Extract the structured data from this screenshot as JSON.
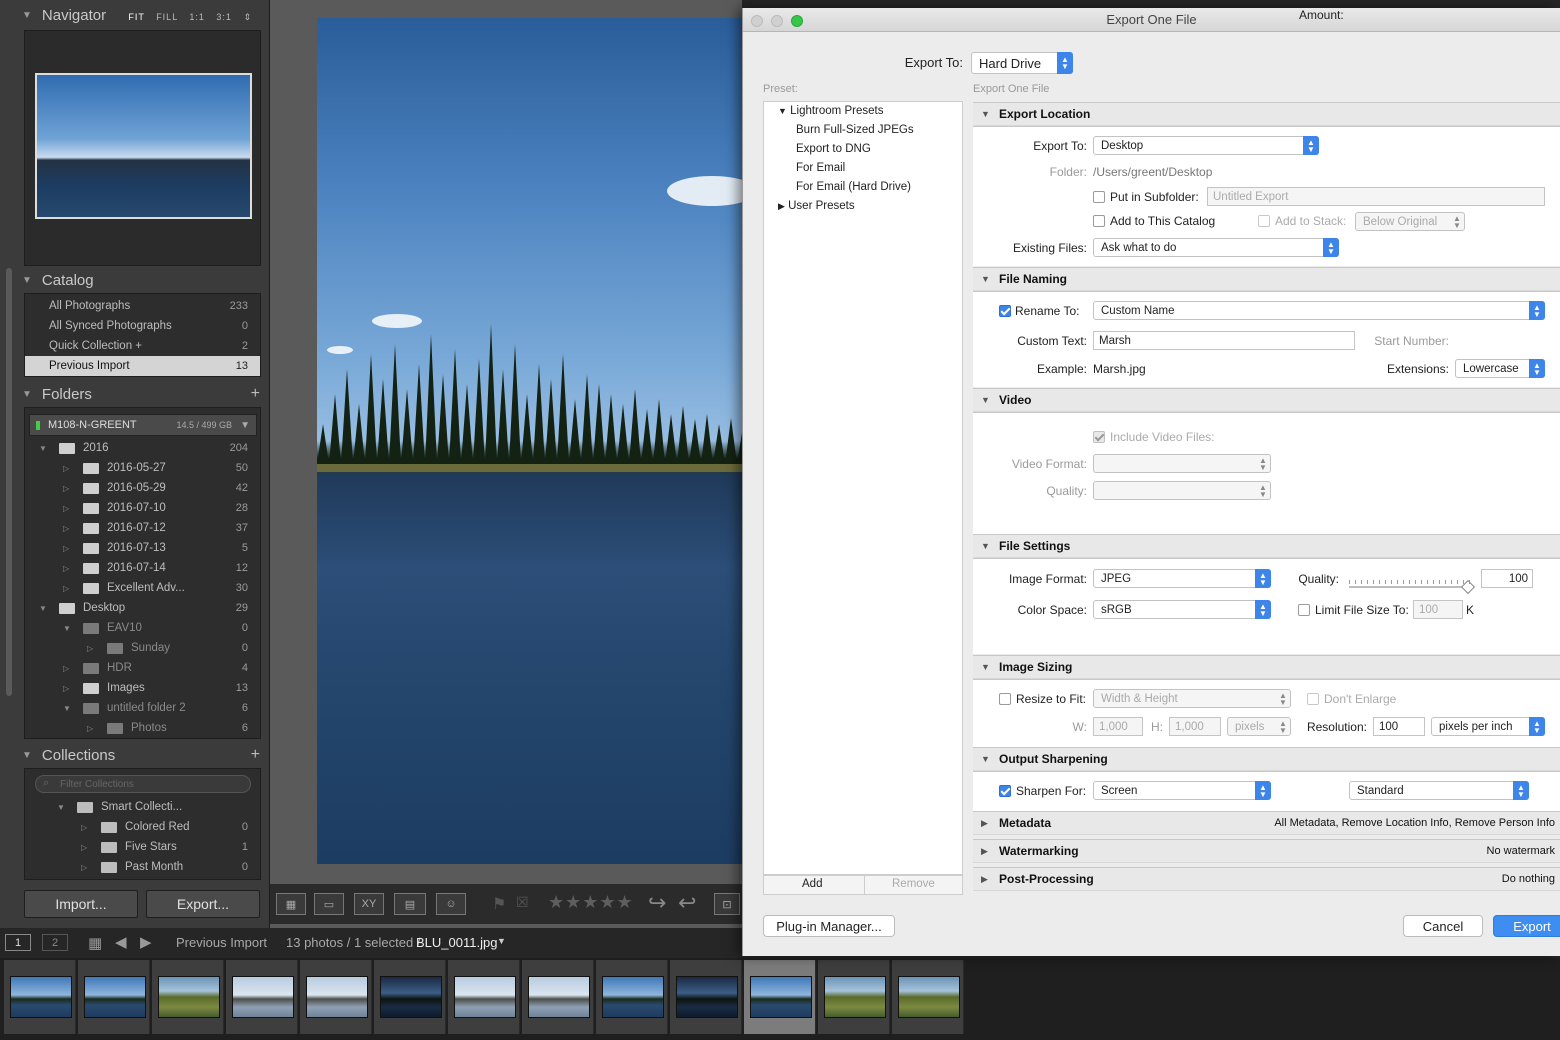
{
  "navigator": {
    "title": "Navigator",
    "modes": [
      "FIT",
      "FILL",
      "1:1",
      "3:1"
    ]
  },
  "catalog": {
    "title": "Catalog",
    "items": [
      {
        "label": "All Photographs",
        "count": "233"
      },
      {
        "label": "All Synced Photographs",
        "count": "0"
      },
      {
        "label": "Quick Collection +",
        "count": "2"
      },
      {
        "label": "Previous Import",
        "count": "13"
      }
    ]
  },
  "folders": {
    "title": "Folders",
    "volume": {
      "name": "M108-N-GREENT",
      "size": "14.5 / 499 GB"
    },
    "items": [
      {
        "label": "2016",
        "count": "204"
      },
      {
        "label": "2016-05-27",
        "count": "50"
      },
      {
        "label": "2016-05-29",
        "count": "42"
      },
      {
        "label": "2016-07-10",
        "count": "28"
      },
      {
        "label": "2016-07-12",
        "count": "37"
      },
      {
        "label": "2016-07-13",
        "count": "5"
      },
      {
        "label": "2016-07-14",
        "count": "12"
      },
      {
        "label": "Excellent Adv...",
        "count": "30"
      },
      {
        "label": "Desktop",
        "count": "29"
      },
      {
        "label": "EAV10",
        "count": "0"
      },
      {
        "label": "Sunday",
        "count": "0"
      },
      {
        "label": "HDR",
        "count": "4"
      },
      {
        "label": "Images",
        "count": "13"
      },
      {
        "label": "untitled folder 2",
        "count": "6"
      },
      {
        "label": "Photos",
        "count": "6"
      }
    ]
  },
  "collections": {
    "title": "Collections",
    "filter_placeholder": "Filter Collections",
    "items": [
      {
        "label": "Smart Collecti...",
        "count": ""
      },
      {
        "label": "Colored Red",
        "count": "0"
      },
      {
        "label": "Five Stars",
        "count": "1"
      },
      {
        "label": "Past Month",
        "count": "0"
      }
    ]
  },
  "left_buttons": {
    "import": "Import...",
    "export": "Export..."
  },
  "filmstrip": {
    "page1": "1",
    "page2": "2",
    "source": "Previous Import",
    "status": "13 photos / 1 selected /",
    "filename": "BLU_0011.jpg"
  },
  "dialog": {
    "title": "Export One File",
    "export_to_label": "Export To:",
    "export_to_value": "Hard Drive",
    "preset_label": "Preset:",
    "preset_name": "Export One File",
    "presets": {
      "lightroom": "Lightroom Presets",
      "items": [
        "Burn Full-Sized JPEGs",
        "Export to DNG",
        "For Email",
        "For Email (Hard Drive)"
      ],
      "user": "User Presets"
    },
    "add_button": "Add",
    "remove_button": "Remove",
    "export_location": {
      "title": "Export Location",
      "export_to_label": "Export To:",
      "export_to_value": "Desktop",
      "folder_label": "Folder:",
      "folder_value": "/Users/greent/Desktop",
      "subfolder_label": "Put in Subfolder:",
      "subfolder_placeholder": "Untitled Export",
      "add_catalog_label": "Add to This Catalog",
      "add_stack_label": "Add to Stack:",
      "stack_value": "Below Original",
      "existing_label": "Existing Files:",
      "existing_value": "Ask what to do"
    },
    "file_naming": {
      "title": "File Naming",
      "rename_label": "Rename To:",
      "rename_value": "Custom Name",
      "custom_text_label": "Custom Text:",
      "custom_text_value": "Marsh",
      "start_number_label": "Start Number:",
      "example_label": "Example:",
      "example_value": "Marsh.jpg",
      "extensions_label": "Extensions:",
      "extensions_value": "Lowercase"
    },
    "video": {
      "title": "Video",
      "include_label": "Include Video Files:",
      "format_label": "Video Format:",
      "quality_label": "Quality:"
    },
    "file_settings": {
      "title": "File Settings",
      "format_label": "Image Format:",
      "format_value": "JPEG",
      "quality_label": "Quality:",
      "quality_value": "100",
      "quality_fraction": 1.0,
      "color_label": "Color Space:",
      "color_value": "sRGB",
      "limit_label": "Limit File Size To:",
      "limit_value": "100",
      "limit_unit": "K"
    },
    "image_sizing": {
      "title": "Image Sizing",
      "resize_label": "Resize to Fit:",
      "resize_value": "Width & Height",
      "dont_enlarge": "Don't Enlarge",
      "w_label": "W:",
      "w_value": "1,000",
      "h_label": "H:",
      "h_value": "1,000",
      "unit_value": "pixels",
      "resolution_label": "Resolution:",
      "resolution_value": "100",
      "resolution_unit": "pixels per inch"
    },
    "output_sharpening": {
      "title": "Output Sharpening",
      "sharpen_label": "Sharpen For:",
      "sharpen_value": "Screen",
      "amount_label": "Amount:",
      "amount_value": "Standard"
    },
    "metadata": {
      "title": "Metadata",
      "summary": "All Metadata, Remove Location Info, Remove Person Info"
    },
    "watermarking": {
      "title": "Watermarking",
      "summary": "No watermark"
    },
    "post_processing": {
      "title": "Post-Processing",
      "summary": "Do nothing"
    },
    "plugin_button": "Plug-in Manager...",
    "cancel_button": "Cancel",
    "export_button": "Export"
  },
  "colors": {
    "accent": "#3d85e8",
    "panel": "#3b3b3b",
    "selected_row": "#d4d4d4"
  }
}
